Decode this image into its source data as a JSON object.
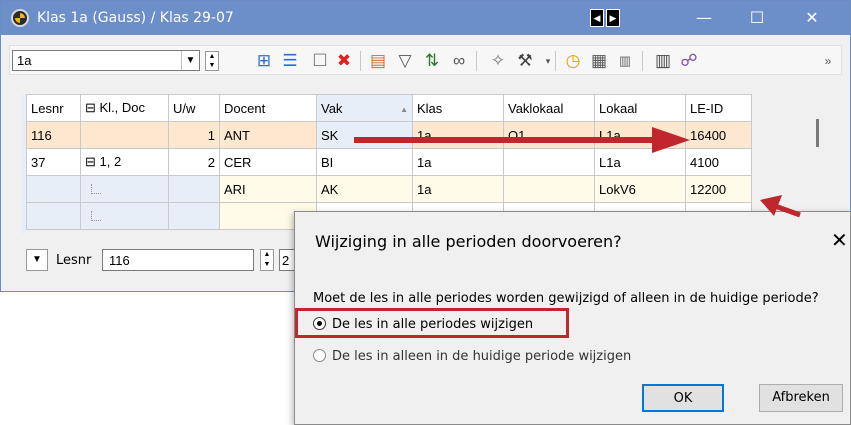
{
  "window": {
    "title": "Klas 1a (Gauss) / Klas  29-07",
    "nav_prev": "◀",
    "nav_next": "▶",
    "minimize": "—",
    "maximize": "☐",
    "close": "✕"
  },
  "toolbar": {
    "class_value": "1a",
    "overflow": "»"
  },
  "grid": {
    "columns": [
      "Lesnr",
      "⊟ Kl., Doc",
      "U/w",
      "Docent",
      "Vak",
      "Klas",
      "Vaklokaal",
      "Lokaal",
      "LE-ID"
    ],
    "sort_indicator": "▲",
    "rows": [
      {
        "lesnr": "116",
        "kldoc": "",
        "uw": "1",
        "docent": "ANT",
        "vak": "SK",
        "klas": "1a",
        "vaklokaal": "O1",
        "lokaal": "L1a",
        "leid": "16400"
      },
      {
        "lesnr": "37",
        "kldoc": "⊟ 1, 2",
        "uw": "2",
        "docent": "CER",
        "vak": "BI",
        "klas": "1a",
        "vaklokaal": "",
        "lokaal": "L1a",
        "leid": "4100"
      },
      {
        "lesnr": "",
        "kldoc": "",
        "uw": "",
        "docent": "ARI",
        "vak": "AK",
        "klas": "1a",
        "vaklokaal": "",
        "lokaal": "LokV6",
        "leid": "12200"
      }
    ]
  },
  "bottom": {
    "lesnr_label": "Lesnr",
    "lesnr_value": "116",
    "second_value": "2"
  },
  "dialog": {
    "title": "Wijziging in alle perioden doorvoeren?",
    "close": "✕",
    "question": "Moet de les in alle periodes worden gewijzigd of alleen in de huidige periode?",
    "option_all": "De les in alle periodes wijzigen",
    "option_current": "De les in alleen in de huidige periode wijzigen",
    "selected_option": "option_all",
    "ok": "OK",
    "cancel": "Afbreken"
  },
  "colors": {
    "titlebar": "#6c8fc9",
    "highlight": "#c0272d",
    "selected_row": "#fde7cf"
  }
}
